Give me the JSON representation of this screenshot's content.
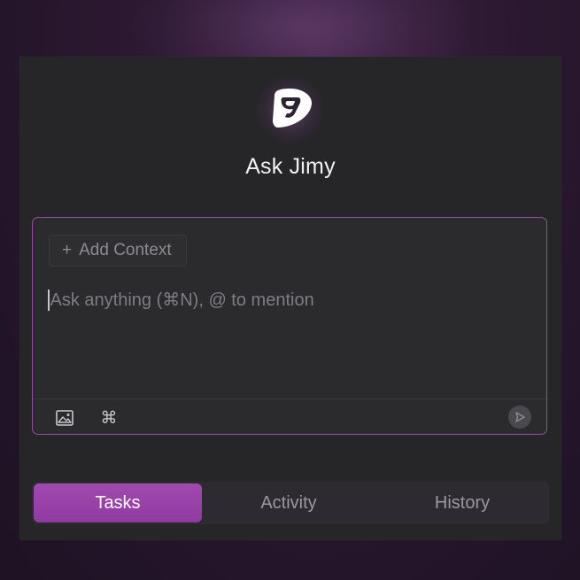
{
  "app": {
    "title": "Ask Jimy"
  },
  "logo": {
    "icon": "jimy-logo-icon"
  },
  "composer": {
    "add_context_label": "Add Context",
    "add_context_icon": "plus-icon",
    "placeholder": "Ask anything (⌘N), @ to mention",
    "value": "",
    "toolbar": {
      "image_icon": "image-icon",
      "command_icon": "command-icon",
      "send_icon": "send-icon"
    }
  },
  "tabs": [
    {
      "label": "Tasks",
      "active": true
    },
    {
      "label": "Activity",
      "active": false
    },
    {
      "label": "History",
      "active": false
    }
  ],
  "colors": {
    "accent": "#9a4aa8",
    "active_tab": "#9a45ab",
    "panel": "#262528"
  }
}
